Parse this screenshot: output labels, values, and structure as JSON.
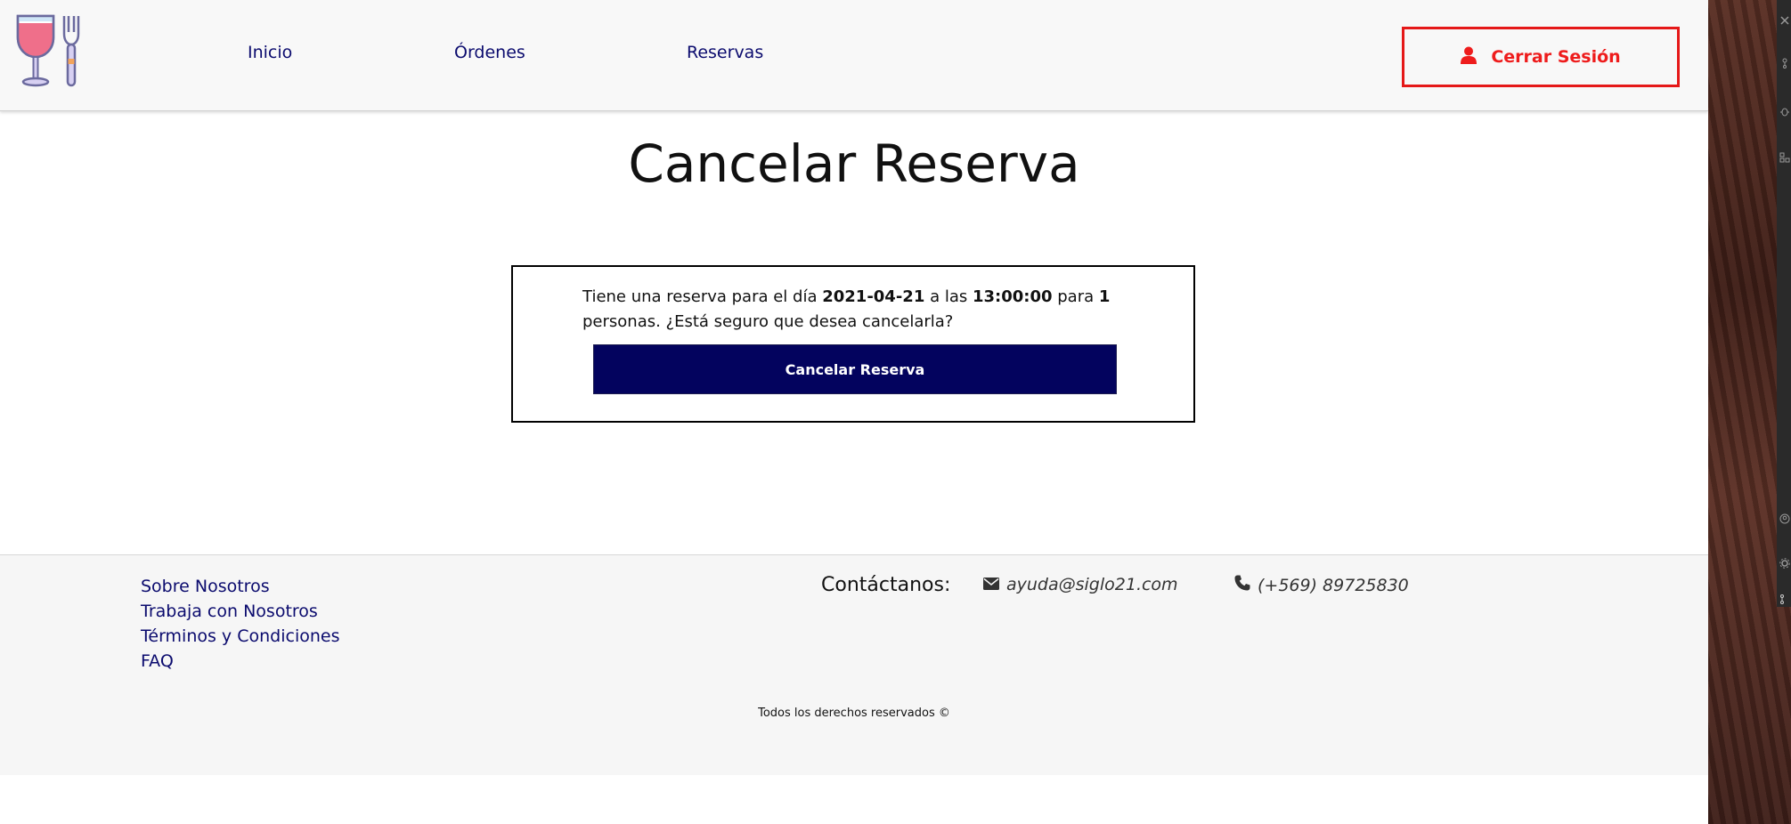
{
  "header": {
    "logo": "wine-glass-and-fork-logo",
    "nav": {
      "inicio": "Inicio",
      "ordenes": "Órdenes",
      "reservas": "Reservas"
    },
    "logout_label": "Cerrar Sesión",
    "logout_icon": "user-icon",
    "accent_color": "#ee1c1c"
  },
  "main": {
    "title": "Cancelar Reserva",
    "message": {
      "prefix": "Tiene una reserva para el día ",
      "date": "2021-04-21",
      "middle": " a las ",
      "time": "13:00:00",
      "para": " para ",
      "persons": "1",
      "suffix": " personas. ¿Está seguro que desea cancelarla?"
    },
    "cancel_button": "Cancelar Reserva",
    "button_color": "#03035e"
  },
  "footer": {
    "links": [
      "Sobre Nosotros",
      "Trabaja con Nosotros",
      "Términos y Condiciones",
      "FAQ"
    ],
    "contact_heading": "Contáctanos:",
    "email": "ayuda@siglo21.com",
    "phone": "(+569) 89725830",
    "copyright": "Todos los derechos reservados ©"
  }
}
